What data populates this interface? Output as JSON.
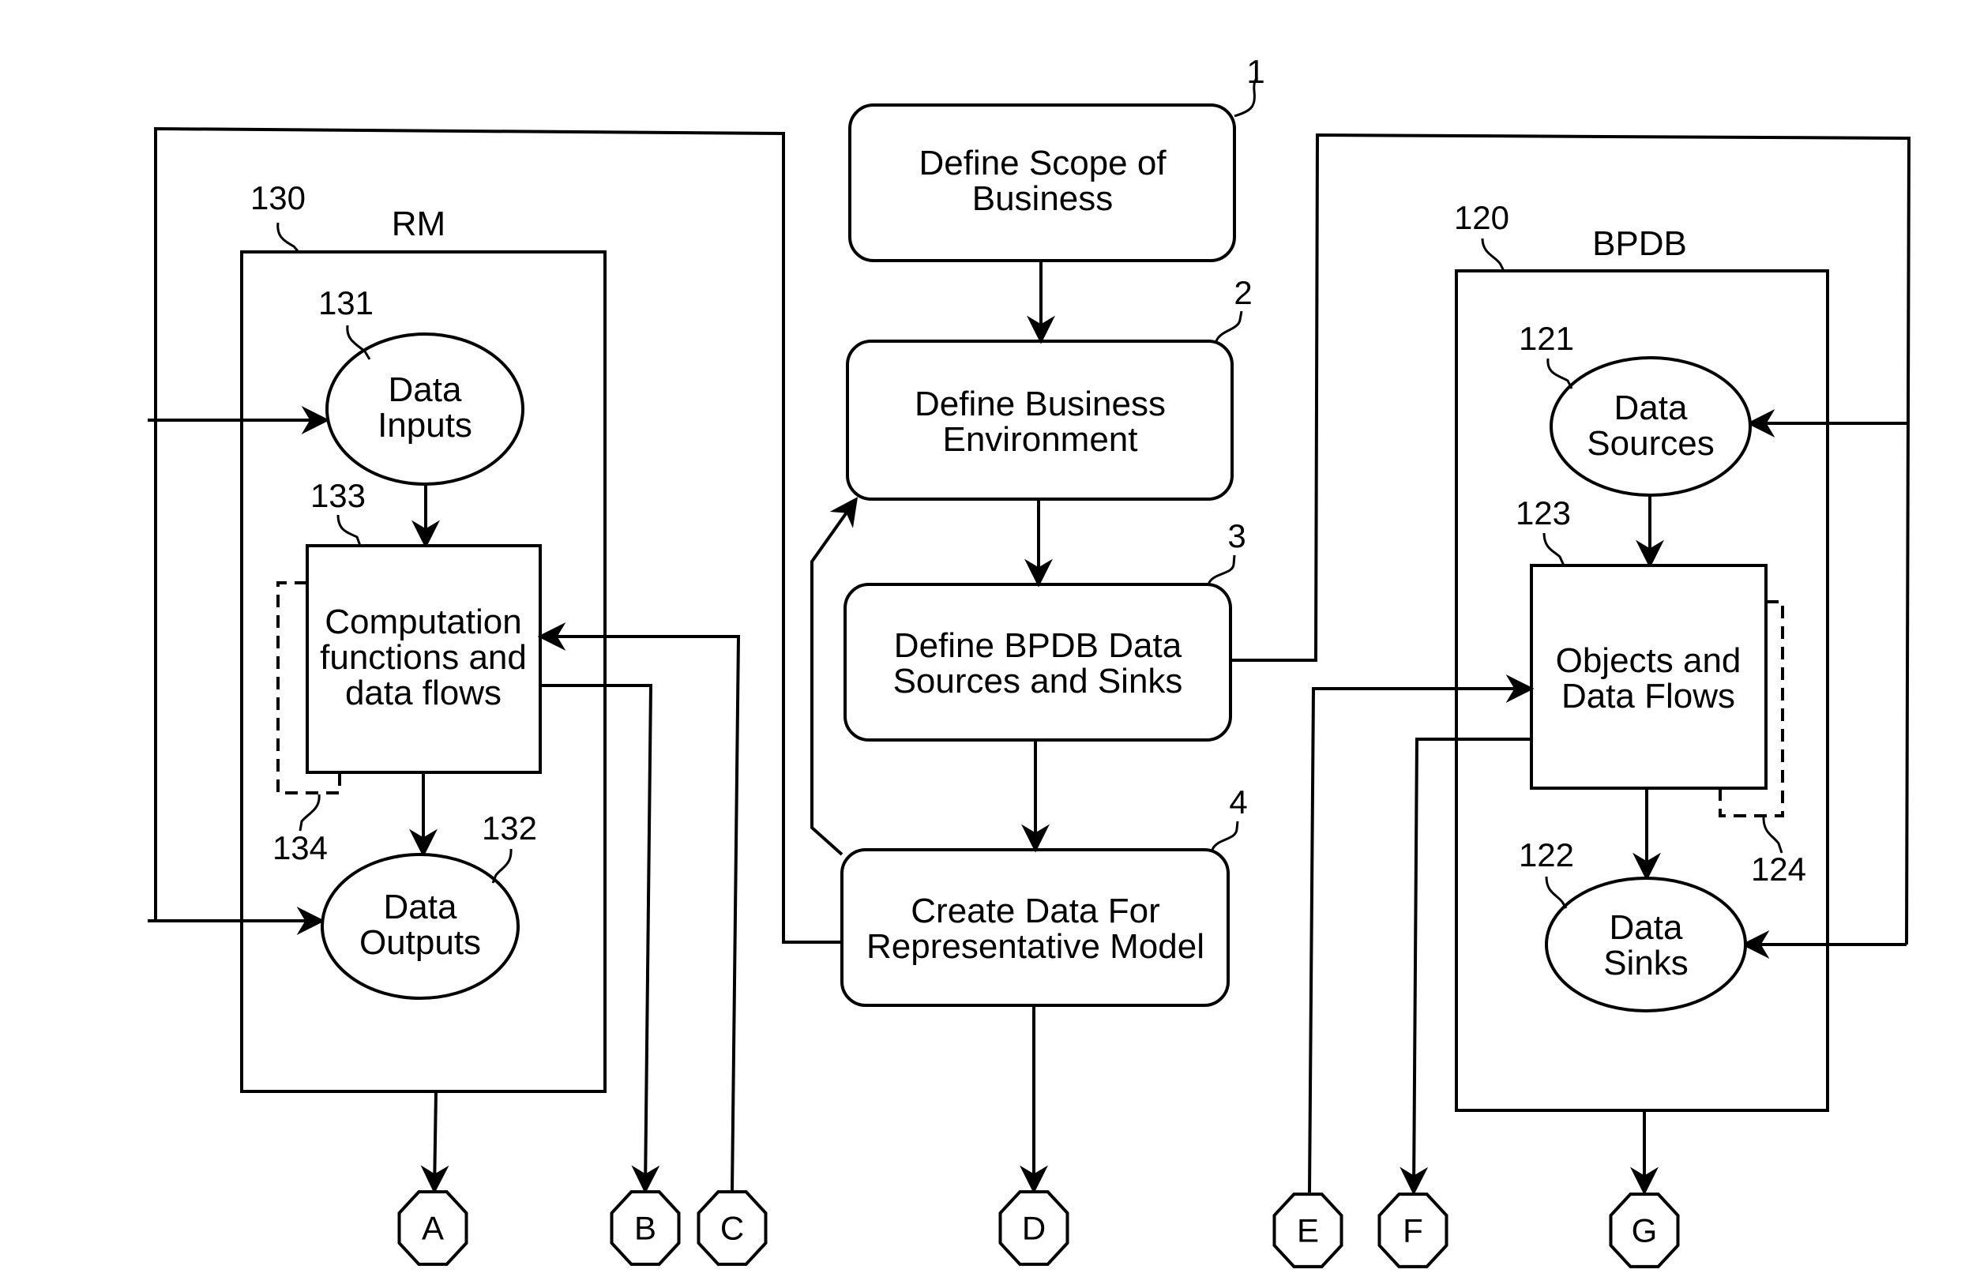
{
  "diagram": {
    "steps": [
      {
        "ref": "1",
        "lines": [
          "Define Scope of",
          "Business"
        ]
      },
      {
        "ref": "2",
        "lines": [
          "Define Business",
          "Environment"
        ]
      },
      {
        "ref": "3",
        "lines": [
          "Define BPDB Data",
          "Sources and Sinks"
        ]
      },
      {
        "ref": "4",
        "lines": [
          "Create Data For",
          "Representative Model"
        ]
      }
    ],
    "rm": {
      "title": "RM",
      "ref": "130",
      "data_inputs": {
        "ref": "131",
        "lines": [
          "Data",
          "Inputs"
        ]
      },
      "computation": {
        "ref": "133",
        "lines": [
          "Computation",
          "functions and",
          "data flows"
        ]
      },
      "data_outputs": {
        "ref": "132",
        "lines": [
          "Data",
          "Outputs"
        ]
      },
      "dashed_ref": "134"
    },
    "bpdb": {
      "title": "BPDB",
      "ref": "120",
      "data_sources": {
        "ref": "121",
        "lines": [
          "Data",
          "Sources"
        ]
      },
      "objects": {
        "ref": "123",
        "lines": [
          "Objects and",
          "Data Flows"
        ]
      },
      "data_sinks": {
        "ref": "122",
        "lines": [
          "Data",
          "Sinks"
        ]
      },
      "dashed_ref": "124"
    },
    "connectors": [
      "A",
      "B",
      "C",
      "D",
      "E",
      "F",
      "G"
    ]
  }
}
